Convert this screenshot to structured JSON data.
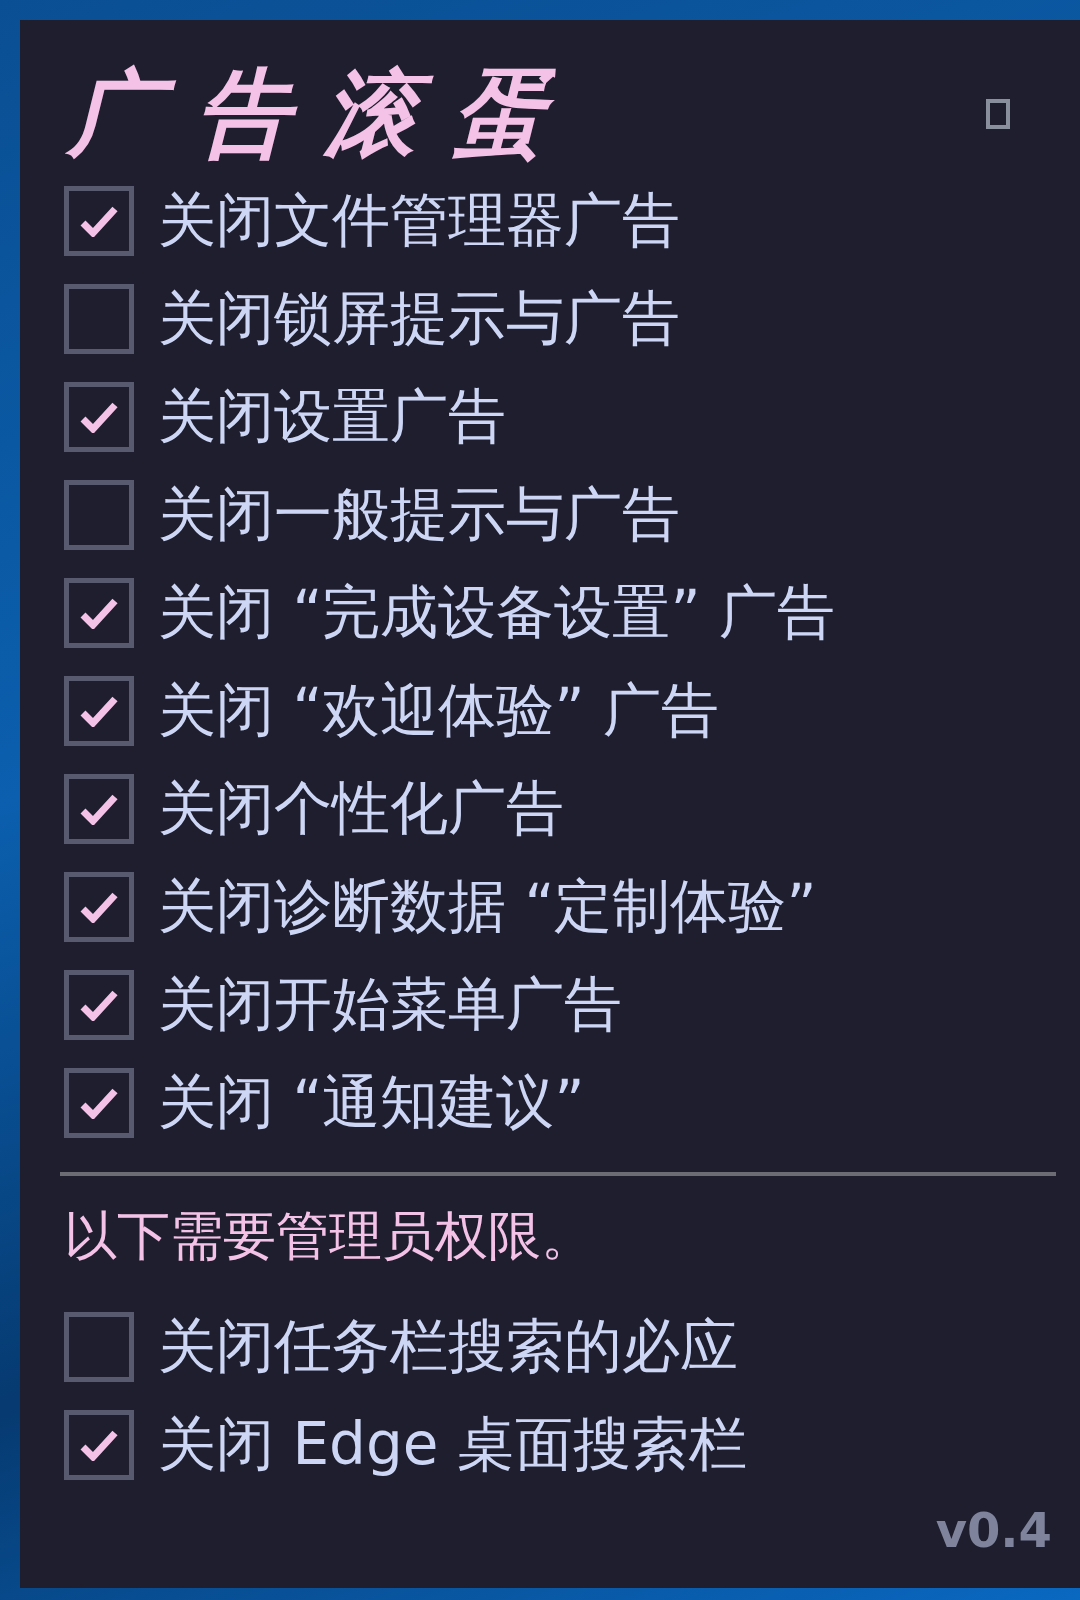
{
  "app": {
    "title": "广告滚蛋",
    "version": "v0.4"
  },
  "options": [
    {
      "label": "关闭文件管理器广告",
      "checked": true
    },
    {
      "label": "关闭锁屏提示与广告",
      "checked": false
    },
    {
      "label": "关闭设置广告",
      "checked": true
    },
    {
      "label": "关闭一般提示与广告",
      "checked": false
    },
    {
      "label": "关闭 “完成设备设置” 广告",
      "checked": true
    },
    {
      "label": "关闭 “欢迎体验” 广告",
      "checked": true
    },
    {
      "label": "关闭个性化广告",
      "checked": true
    },
    {
      "label": "关闭诊断数据 “定制体验”",
      "checked": true
    },
    {
      "label": "关闭开始菜单广告",
      "checked": true
    },
    {
      "label": "关闭 “通知建议”",
      "checked": true
    }
  ],
  "admin_section": {
    "note": "以下需要管理员权限。",
    "options": [
      {
        "label": "关闭任务栏搜索的必应",
        "checked": false
      },
      {
        "label": "关闭 Edge 桌面搜索栏",
        "checked": true
      }
    ]
  }
}
